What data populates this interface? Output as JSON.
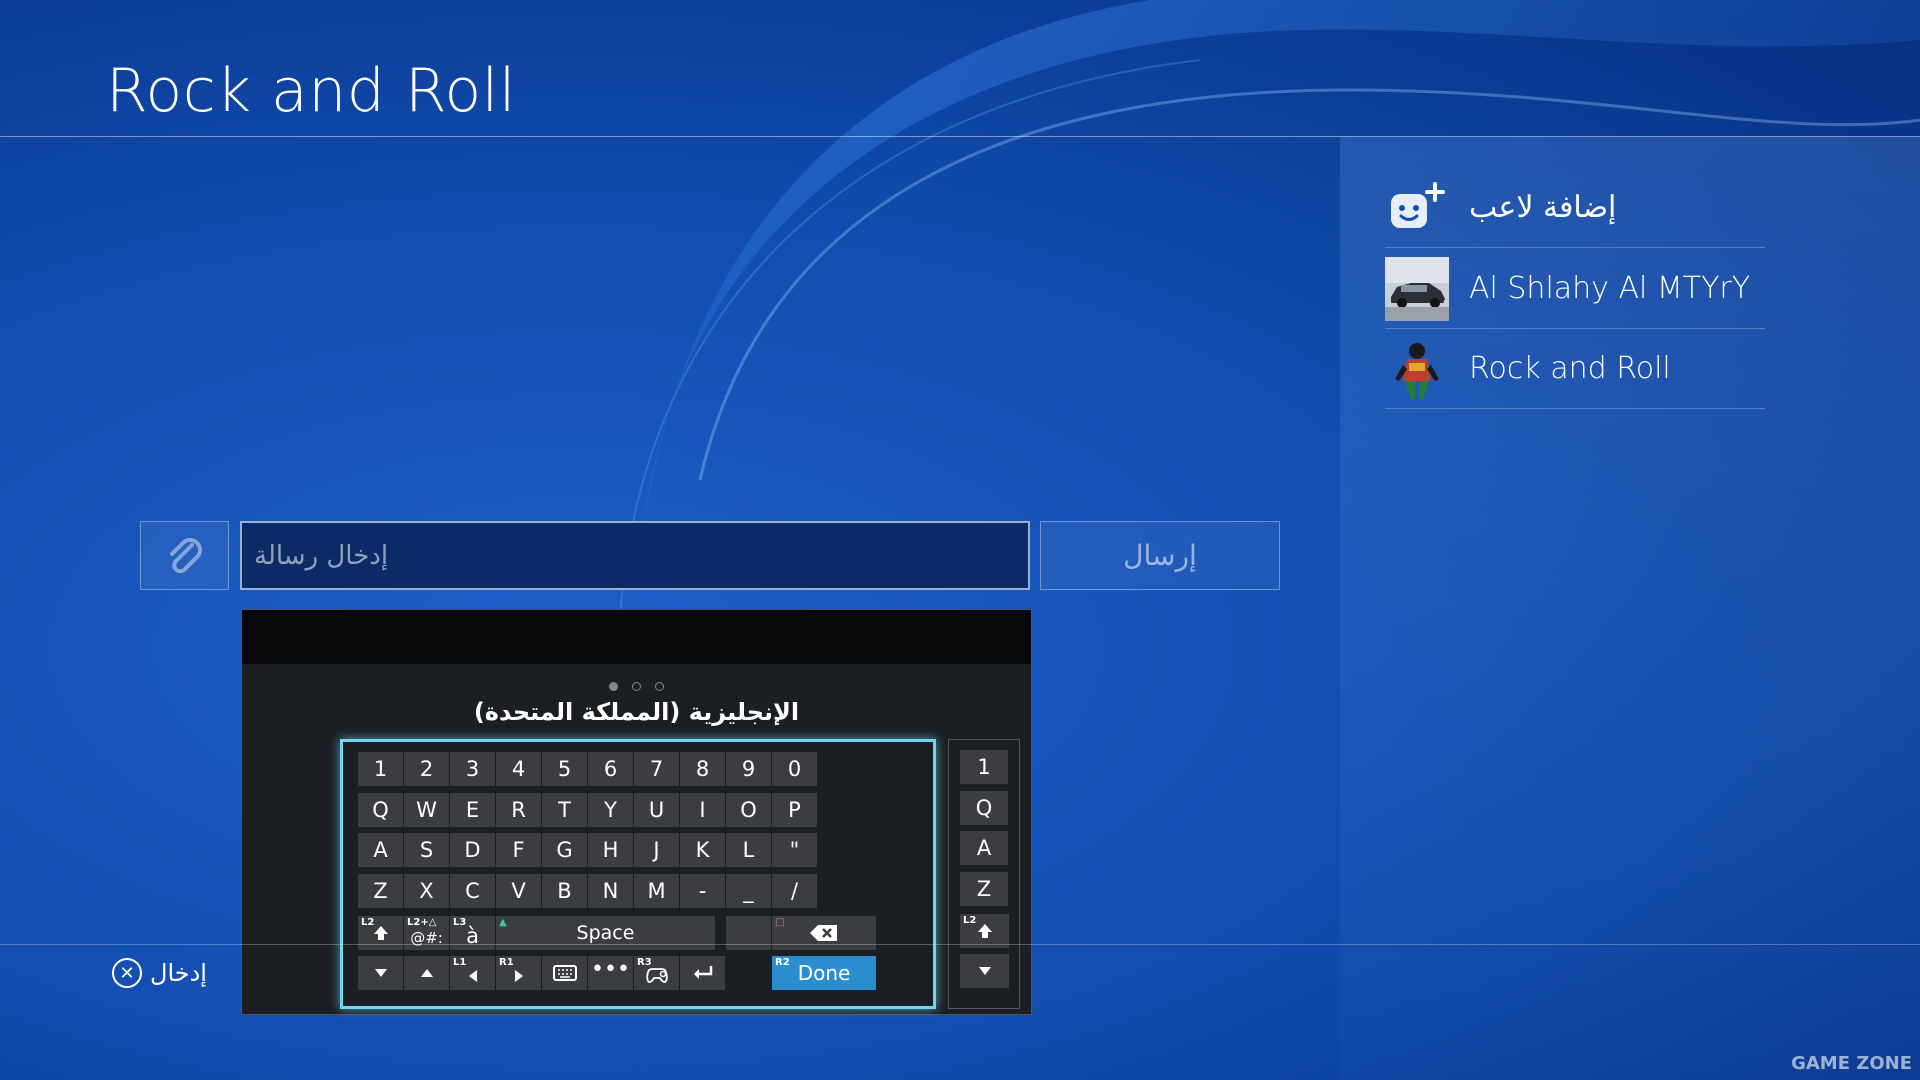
{
  "header": {
    "title": "Rock and Roll"
  },
  "players": {
    "add_label": "إضافة لاعب",
    "items": [
      {
        "name": "Al Shlahy Al MTYrY",
        "avatar": "car-photo-avatar"
      },
      {
        "name": "Rock and Roll",
        "avatar": "character-avatar"
      }
    ]
  },
  "composer": {
    "placeholder": "إدخال رسالة",
    "send_label": "إرسال",
    "attach_icon": "paperclip-icon"
  },
  "keyboard": {
    "language": "الإنجليزية (المملكة المتحدة)",
    "rows": [
      [
        "1",
        "2",
        "3",
        "4",
        "5",
        "6",
        "7",
        "8",
        "9",
        "0"
      ],
      [
        "Q",
        "W",
        "E",
        "R",
        "T",
        "Y",
        "U",
        "I",
        "O",
        "P"
      ],
      [
        "A",
        "S",
        "D",
        "F",
        "G",
        "H",
        "J",
        "K",
        "L",
        "\""
      ],
      [
        "Z",
        "X",
        "C",
        "V",
        "B",
        "N",
        "M",
        "-",
        "_",
        "/"
      ]
    ],
    "symbols_key": "@#:",
    "accent_key": "à",
    "space_label": "Space",
    "done_label": "Done",
    "tags": {
      "l2": "L2",
      "l2tri": "L2+△",
      "l3": "L3",
      "l1": "L1",
      "r1": "R1",
      "r3": "R3",
      "r2": "R2"
    },
    "side_keys": [
      "1",
      "Q",
      "A",
      "Z"
    ]
  },
  "footer": {
    "enter_label": "إدخال",
    "watermark": "GAME ZONE"
  },
  "colors": {
    "accent": "#6fd6ee",
    "done": "#2b8fcf",
    "background": "#1450b4"
  }
}
